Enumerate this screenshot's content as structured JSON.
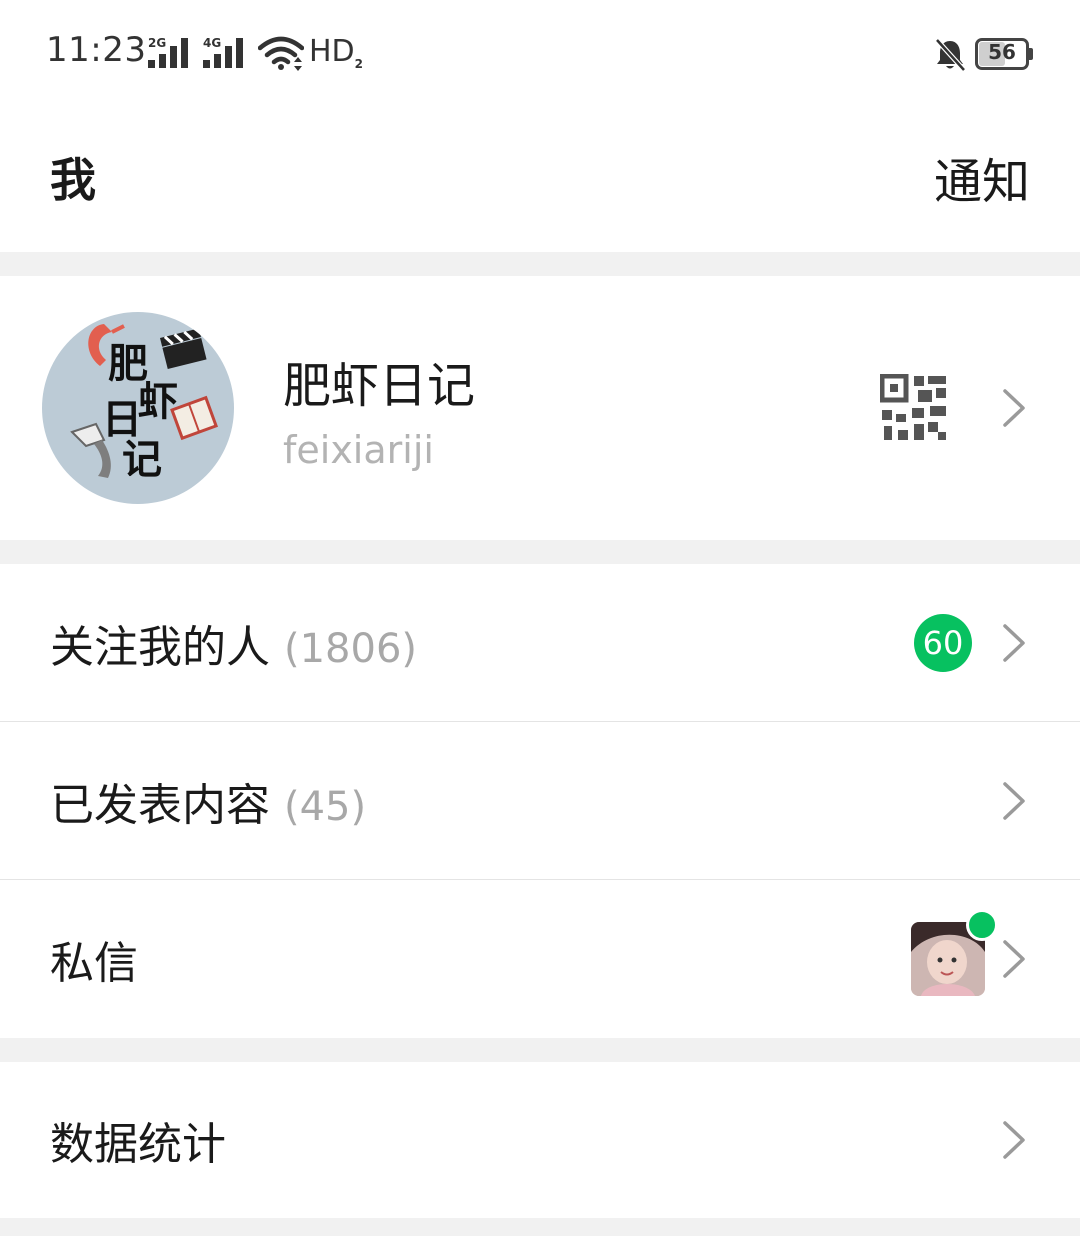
{
  "status_bar": {
    "time": "11:23",
    "signal_1_label": "2G",
    "signal_2_label": "4G",
    "hd_label": "HD",
    "hd_sub": "2",
    "battery_level": "56",
    "icons": [
      "signal-2g-icon",
      "signal-4g-icon",
      "wifi-icon",
      "mute-bell-icon",
      "battery-icon"
    ]
  },
  "header": {
    "title": "我",
    "notify_label": "通知"
  },
  "profile": {
    "avatar_text": [
      "肥",
      "虾",
      "日",
      "记"
    ],
    "name": "肥虾日记",
    "user_id": "feixiariji",
    "icons": [
      "qr-code-icon",
      "chevron-right-icon"
    ]
  },
  "menu": {
    "followers": {
      "label": "关注我的人",
      "count": "(1806)",
      "badge": "60"
    },
    "published": {
      "label": "已发表内容",
      "count": "(45)"
    },
    "messages": {
      "label": "私信"
    },
    "stats": {
      "label": "数据统计"
    }
  },
  "colors": {
    "accent_green": "#07c160",
    "separator_band": "#f1f1f1",
    "secondary_text": "#a8a8a8"
  }
}
